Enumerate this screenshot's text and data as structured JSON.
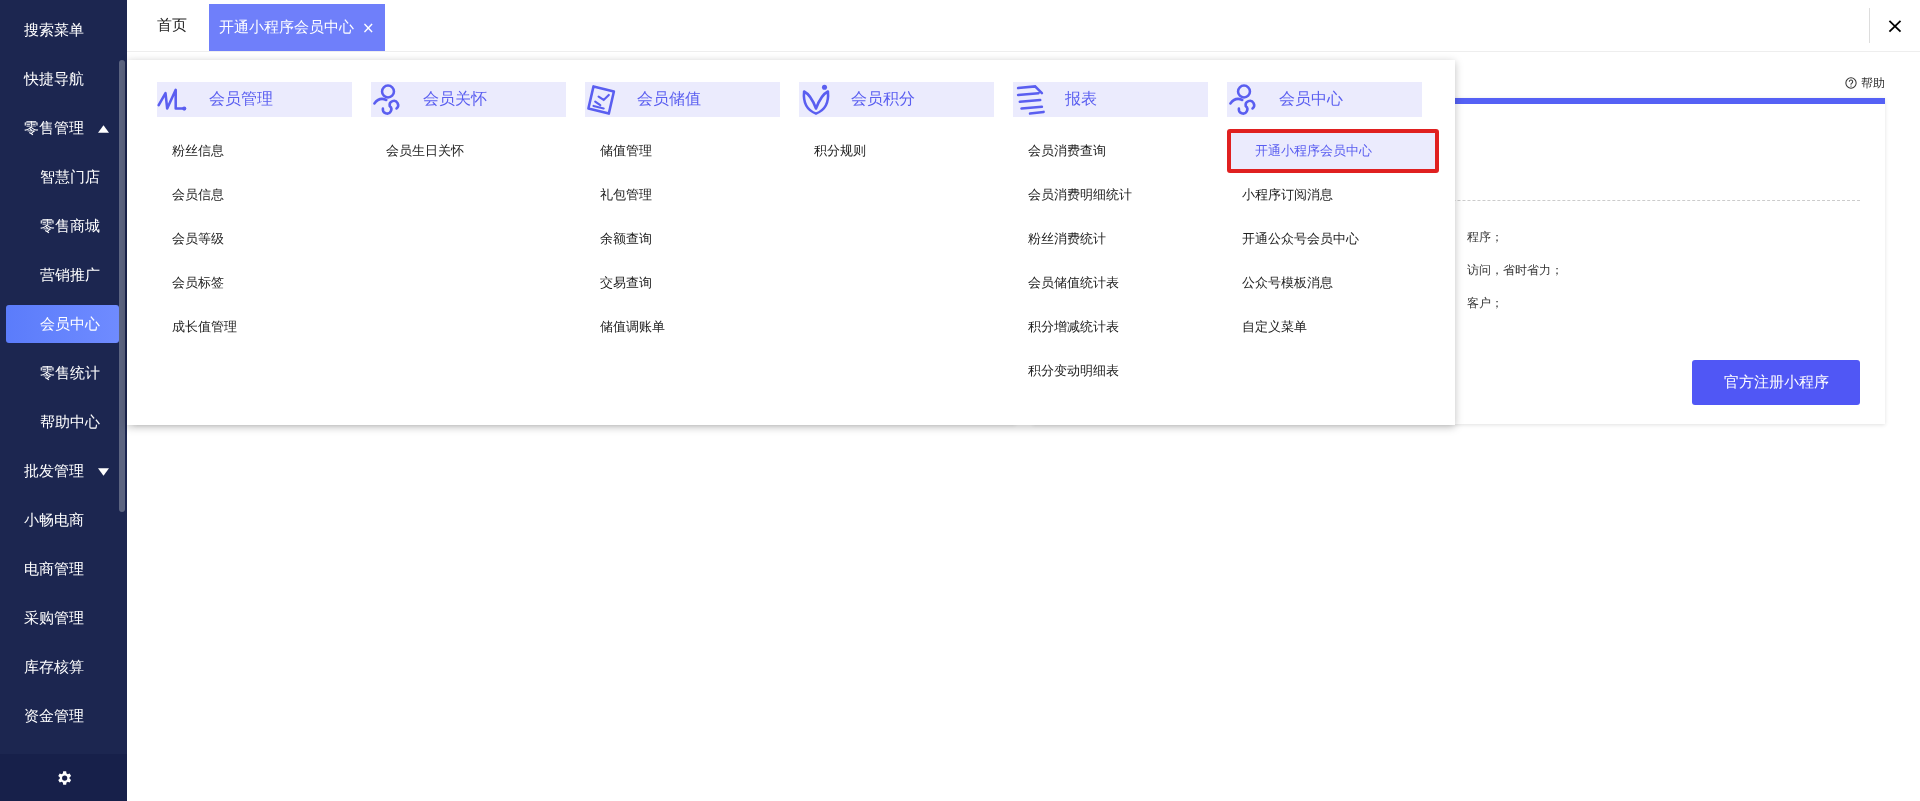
{
  "sidebar": {
    "items": [
      {
        "label": "搜索菜单",
        "kind": "link",
        "selected": false
      },
      {
        "label": "快捷导航",
        "kind": "link",
        "selected": false
      },
      {
        "label": "零售管理",
        "kind": "group",
        "expanded": true,
        "selected": false,
        "children": [
          {
            "label": "智慧门店",
            "selected": false
          },
          {
            "label": "零售商城",
            "selected": false
          },
          {
            "label": "营销推广",
            "selected": false
          },
          {
            "label": "会员中心",
            "selected": true
          },
          {
            "label": "零售统计",
            "selected": false
          },
          {
            "label": "帮助中心",
            "selected": false
          }
        ]
      },
      {
        "label": "批发管理",
        "kind": "group",
        "expanded": false,
        "selected": false
      },
      {
        "label": "小畅电商",
        "kind": "link",
        "selected": false
      },
      {
        "label": "电商管理",
        "kind": "link",
        "selected": false
      },
      {
        "label": "采购管理",
        "kind": "link",
        "selected": false
      },
      {
        "label": "库存核算",
        "kind": "link",
        "selected": false
      },
      {
        "label": "资金管理",
        "kind": "link",
        "selected": false
      }
    ]
  },
  "tabs": [
    {
      "label": "首页",
      "selected": false,
      "closable": false
    },
    {
      "label": "开通小程序会员中心",
      "selected": true,
      "closable": true,
      "close": "×"
    }
  ],
  "window_close": "×",
  "help": {
    "label": "帮助"
  },
  "panel": {
    "lines": [
      "程序；",
      "访问，省时省力；",
      "客户；"
    ],
    "button": "官方注册小程序"
  },
  "menu": {
    "columns": [
      {
        "title": "会员管理",
        "items": [
          {
            "label": "粉丝信息",
            "selected": false,
            "annotated": false
          },
          {
            "label": "会员信息",
            "selected": false,
            "annotated": false
          },
          {
            "label": "会员等级",
            "selected": false,
            "annotated": false
          },
          {
            "label": "会员标签",
            "selected": false,
            "annotated": false
          },
          {
            "label": "成长值管理",
            "selected": false,
            "annotated": false
          }
        ]
      },
      {
        "title": "会员关怀",
        "items": [
          {
            "label": "会员生日关怀",
            "selected": false,
            "annotated": false
          }
        ]
      },
      {
        "title": "会员储值",
        "items": [
          {
            "label": "储值管理",
            "selected": false,
            "annotated": false
          },
          {
            "label": "礼包管理",
            "selected": false,
            "annotated": false
          },
          {
            "label": "余额查询",
            "selected": false,
            "annotated": false
          },
          {
            "label": "交易查询",
            "selected": false,
            "annotated": false
          },
          {
            "label": "储值调账单",
            "selected": false,
            "annotated": false
          }
        ]
      },
      {
        "title": "会员积分",
        "items": [
          {
            "label": "积分规则",
            "selected": false,
            "annotated": false
          }
        ]
      },
      {
        "title": "报表",
        "items": [
          {
            "label": "会员消费查询",
            "selected": false,
            "annotated": false
          },
          {
            "label": "会员消费明细统计",
            "selected": false,
            "annotated": false
          },
          {
            "label": "粉丝消费统计",
            "selected": false,
            "annotated": false
          },
          {
            "label": "会员储值统计表",
            "selected": false,
            "annotated": false
          },
          {
            "label": "积分增减统计表",
            "selected": false,
            "annotated": false
          },
          {
            "label": "积分变动明细表",
            "selected": false,
            "annotated": false
          }
        ]
      },
      {
        "title": "会员中心",
        "items": [
          {
            "label": "开通小程序会员中心",
            "selected": true,
            "annotated": true
          },
          {
            "label": "小程序订阅消息",
            "selected": false,
            "annotated": false
          },
          {
            "label": "开通公众号会员中心",
            "selected": false,
            "annotated": false
          },
          {
            "label": "公众号模板消息",
            "selected": false,
            "annotated": false
          },
          {
            "label": "自定义菜单",
            "selected": false,
            "annotated": false
          }
        ]
      }
    ]
  }
}
